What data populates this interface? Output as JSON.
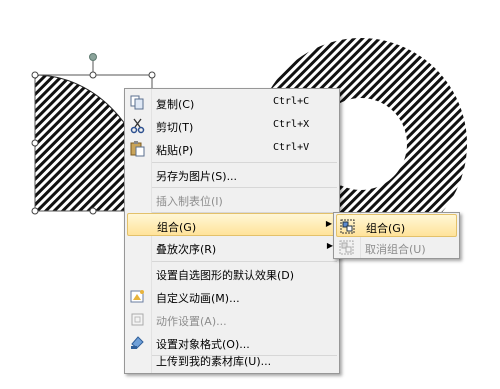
{
  "context_menu": {
    "items": [
      {
        "label": "复制(C)",
        "shortcut": "Ctrl+C",
        "icon": "copy-icon"
      },
      {
        "label": "剪切(T)",
        "shortcut": "Ctrl+X",
        "icon": "cut-icon"
      },
      {
        "label": "粘贴(P)",
        "shortcut": "Ctrl+V",
        "icon": "paste-icon"
      },
      {
        "label": "另存为图片(S)..."
      },
      {
        "label": "插入制表位(I)"
      },
      {
        "label": "组合(G)"
      },
      {
        "label": "叠放次序(R)"
      },
      {
        "label": "设置自选图形的默认效果(D)"
      },
      {
        "label": "自定义动画(M)...",
        "icon": "custom-animation-icon"
      },
      {
        "label": "动作设置(A)...",
        "icon": "action-settings-icon"
      },
      {
        "label": "设置对象格式(O)...",
        "icon": "format-object-icon"
      },
      {
        "label": "上传到我的素材库(U)..."
      }
    ]
  },
  "submenu": {
    "items": [
      {
        "label": "组合(G)",
        "icon": "group-icon"
      },
      {
        "label": "取消组合(U)",
        "icon": "ungroup-icon"
      }
    ]
  },
  "colors": {
    "highlight": "#ffe39a",
    "menu_background": "#f0f0f0",
    "disabled_text": "#8d8d8d",
    "shape_hatch": "#111111"
  }
}
